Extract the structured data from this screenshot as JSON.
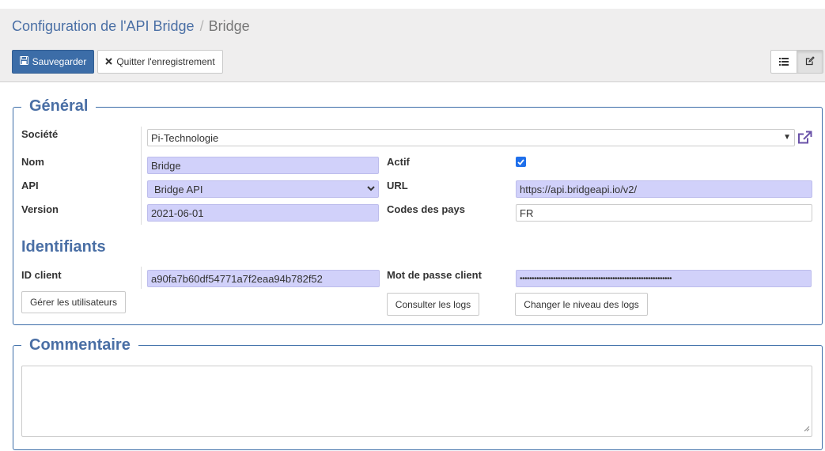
{
  "breadcrumb": {
    "parent": "Configuration de l'API Bridge",
    "separator": "/",
    "current": "Bridge"
  },
  "toolbar": {
    "save_label": "Sauvegarder",
    "quit_label": "Quitter l'enregistrement",
    "view_list_icon": "list-icon",
    "view_form_icon": "edit-icon"
  },
  "general": {
    "legend": "Général",
    "societe_label": "Société",
    "societe_value": "Pi-Technologie",
    "nom_label": "Nom",
    "nom_value": "Bridge",
    "api_label": "API",
    "api_value": "Bridge API",
    "version_label": "Version",
    "version_value": "2021-06-01",
    "actif_label": "Actif",
    "actif_checked": true,
    "url_label": "URL",
    "url_value": "https://api.bridgeapi.io/v2/",
    "codes_pays_label": "Codes des pays",
    "codes_pays_value": "FR"
  },
  "identifiants": {
    "title": "Identifiants",
    "client_id_label": "ID client",
    "client_id_value": "a90fa7b60df54771a7f2eaa94b782f52",
    "password_label": "Mot de passe client",
    "password_value": "••••••••••••••••••••••••••••••••••••••••••••••••••••••••••••••••",
    "manage_users_label": "Gérer les utilisateurs",
    "view_logs_label": "Consulter les logs",
    "change_log_level_label": "Changer le niveau des logs"
  },
  "commentaire": {
    "legend": "Commentaire",
    "value": ""
  },
  "colors": {
    "primary": "#3c6da8",
    "title": "#4a6fa5",
    "required_field": "#d1d1fa",
    "panel_bg": "#efeeee"
  }
}
